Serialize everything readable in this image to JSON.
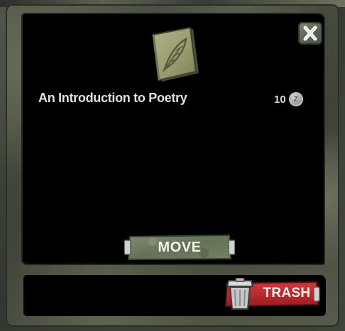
{
  "dialog": {
    "item": {
      "title": "An Introduction to Poetry",
      "price": "10",
      "coin_symbol": "Z",
      "icon": "book-feather-icon"
    },
    "close": {
      "icon": "close-x-icon"
    },
    "actions": {
      "move_label": "MOVE",
      "trash_label": "TRASH",
      "trash_icon": "trash-can-icon"
    }
  },
  "colors": {
    "panel_bg": "#000000",
    "frame": "#4f5446",
    "move_button": "#6d7a60",
    "trash_button": "#b8262a",
    "text": "#e3e3dc"
  }
}
